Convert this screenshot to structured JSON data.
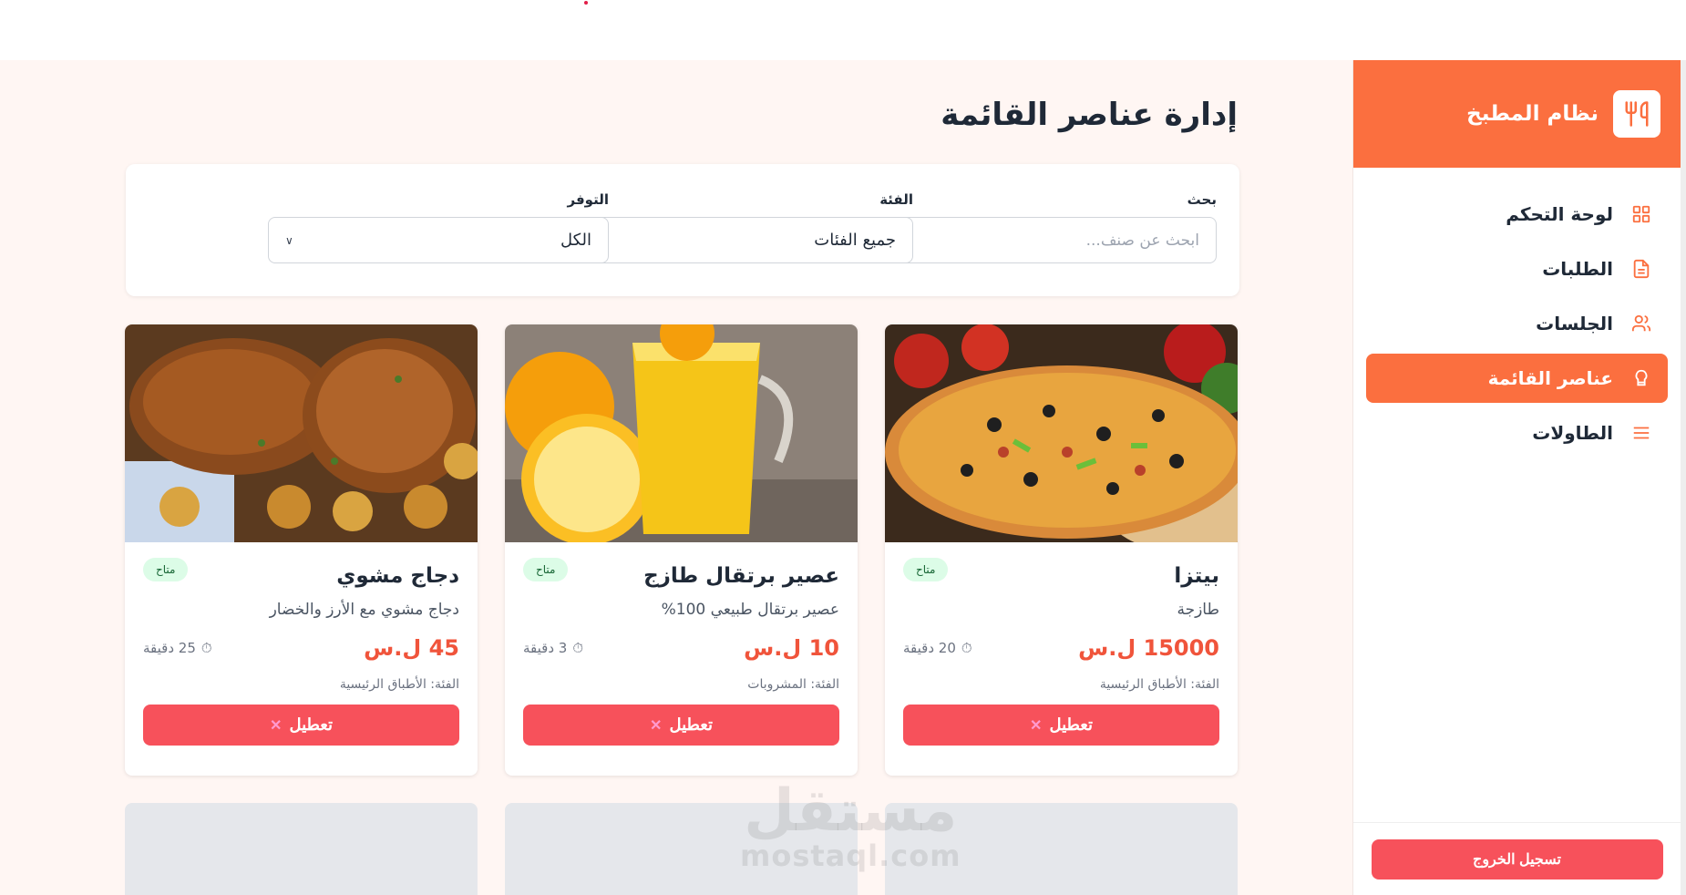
{
  "sidebar": {
    "brand": "نظام المطبخ",
    "items": [
      {
        "label": "لوحة التحكم",
        "icon": "grid-icon",
        "active": false
      },
      {
        "label": "الطلبات",
        "icon": "document-icon",
        "active": false
      },
      {
        "label": "الجلسات",
        "icon": "users-icon",
        "active": false
      },
      {
        "label": "عناصر القائمة",
        "icon": "chef-hat-icon",
        "active": true
      },
      {
        "label": "الطاولات",
        "icon": "menu-lines-icon",
        "active": false
      }
    ],
    "logout": "تسجيل الخروج"
  },
  "main": {
    "title": "إدارة عناصر القائمة",
    "filters": {
      "search": {
        "label": "بحث",
        "placeholder": "ابحث عن صنف..."
      },
      "category": {
        "label": "الفئة",
        "value": "جميع الفئات"
      },
      "availability": {
        "label": "التوفر",
        "value": "الكل"
      }
    },
    "cards": [
      {
        "name": "بيتزا",
        "description": "طازجة",
        "price": "15000 ل.س",
        "time": "20 دقيقة",
        "category": "الفئة: الأطباق الرئيسية",
        "status": "متاح",
        "button": "تعطيل"
      },
      {
        "name": "عصير برتقال طازج",
        "description": "عصير برتقال طبيعي 100%",
        "price": "10 ل.س",
        "time": "3 دقيقة",
        "category": "الفئة: المشروبات",
        "status": "متاح",
        "button": "تعطيل"
      },
      {
        "name": "دجاج مشوي",
        "description": "دجاج مشوي مع الأرز والخضار",
        "price": "45 ل.س",
        "time": "25 دقيقة",
        "category": "الفئة: الأطباق الرئيسية",
        "status": "متاح",
        "button": "تعطيل"
      }
    ]
  },
  "watermark": {
    "arabic": "مستقل",
    "latin": "mostaql.com"
  },
  "colors": {
    "accent": "#fb6f3f",
    "danger": "#f7515b",
    "price": "#f0543b",
    "badge_bg": "#dcfce7"
  }
}
